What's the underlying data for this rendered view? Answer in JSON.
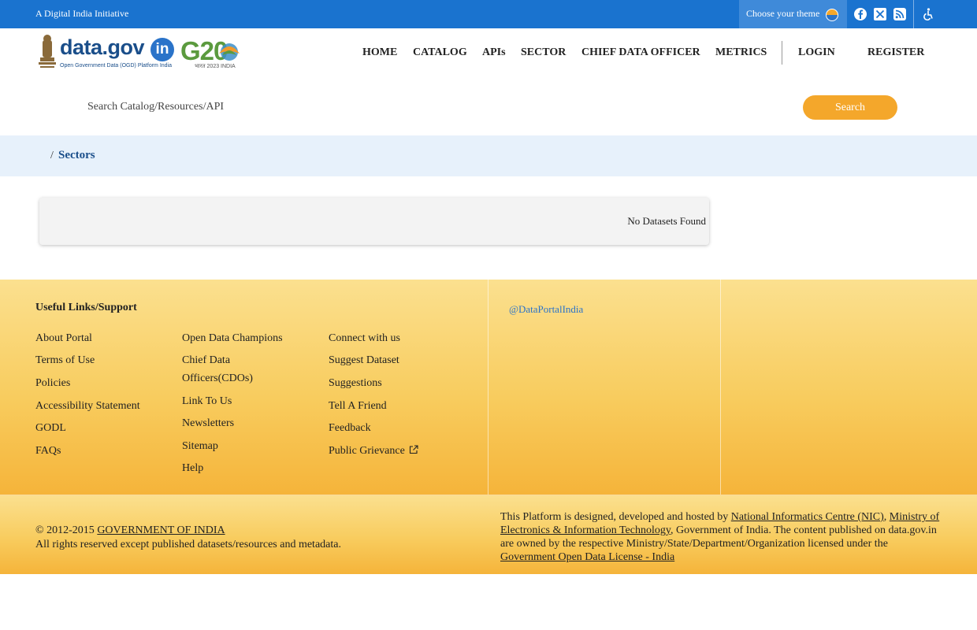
{
  "topbar": {
    "initiative": "A Digital India Initiative",
    "theme_label": "Choose your theme"
  },
  "logo": {
    "wordmark": "data.gov",
    "wordmark_suffix": "in",
    "tagline": "Open Government Data (OGD) Platform India",
    "g20": "G20",
    "g20_sub": "भारत 2023 INDIA"
  },
  "nav": {
    "items": [
      "HOME",
      "CATALOG",
      "APIs",
      "SECTOR",
      "CHIEF DATA OFFICER",
      "METRICS"
    ],
    "login": "LOGIN",
    "register": "REGISTER"
  },
  "search": {
    "placeholder": "Search Catalog/Resources/API",
    "button": "Search"
  },
  "breadcrumb": {
    "separator": "/",
    "current": "Sectors"
  },
  "results": {
    "message": "No Datasets Found"
  },
  "footer": {
    "heading": "Useful Links/Support",
    "col1": [
      "About Portal",
      "Terms of Use",
      "Policies",
      "Accessibility Statement",
      "GODL",
      "FAQs"
    ],
    "col2": [
      "Open Data Champions",
      "Chief Data Officers(CDOs)",
      "Link To Us",
      "Newsletters",
      "Sitemap",
      "Help"
    ],
    "col3": [
      "Connect with us",
      "Suggest Dataset",
      "Suggestions",
      "Tell A Friend",
      "Feedback",
      "Public Grievance"
    ],
    "twitter_handle": "@DataPortalIndia"
  },
  "bottom": {
    "copyright_prefix": "© 2012-2015 ",
    "copyright_link": "GOVERNMENT OF INDIA",
    "rights": "All rights reserved except published datasets/resources and metadata.",
    "hosted_prefix": "This Platform is designed, developed and hosted by ",
    "nic": "National Informatics Centre (NIC)",
    "comma": ",",
    "meity": "Ministry of Electronics & Information Technology",
    "hosted_middle": ", Government of India. The content published on data.gov.in are owned by the respective Ministry/State/Department/Organization licensed under the ",
    "license": "Government Open Data License - India"
  },
  "icons": {
    "facebook": "facebook-icon",
    "twitter": "x-twitter-icon",
    "rss": "rss-icon",
    "accessibility": "accessibility-icon",
    "external": "external-link-icon"
  },
  "colors": {
    "topbar": "#1a73cf",
    "accent": "#f4a72b",
    "breadcrumb_bg": "#e7f1fb",
    "link_blue": "#1a4e8a"
  }
}
